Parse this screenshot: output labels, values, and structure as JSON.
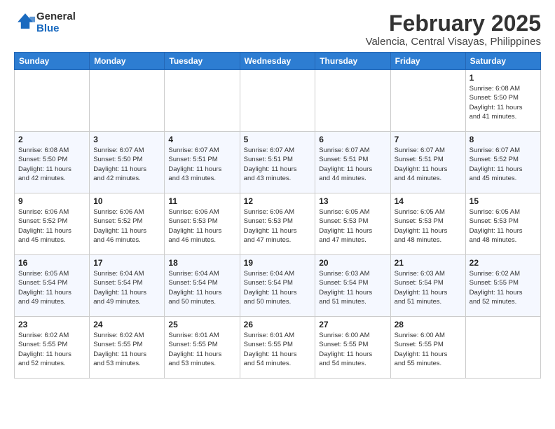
{
  "header": {
    "logo_general": "General",
    "logo_blue": "Blue",
    "month_year": "February 2025",
    "location": "Valencia, Central Visayas, Philippines"
  },
  "days_of_week": [
    "Sunday",
    "Monday",
    "Tuesday",
    "Wednesday",
    "Thursday",
    "Friday",
    "Saturday"
  ],
  "weeks": [
    [
      {
        "day": "",
        "info": ""
      },
      {
        "day": "",
        "info": ""
      },
      {
        "day": "",
        "info": ""
      },
      {
        "day": "",
        "info": ""
      },
      {
        "day": "",
        "info": ""
      },
      {
        "day": "",
        "info": ""
      },
      {
        "day": "1",
        "info": "Sunrise: 6:08 AM\nSunset: 5:50 PM\nDaylight: 11 hours\nand 41 minutes."
      }
    ],
    [
      {
        "day": "2",
        "info": "Sunrise: 6:08 AM\nSunset: 5:50 PM\nDaylight: 11 hours\nand 42 minutes."
      },
      {
        "day": "3",
        "info": "Sunrise: 6:07 AM\nSunset: 5:50 PM\nDaylight: 11 hours\nand 42 minutes."
      },
      {
        "day": "4",
        "info": "Sunrise: 6:07 AM\nSunset: 5:51 PM\nDaylight: 11 hours\nand 43 minutes."
      },
      {
        "day": "5",
        "info": "Sunrise: 6:07 AM\nSunset: 5:51 PM\nDaylight: 11 hours\nand 43 minutes."
      },
      {
        "day": "6",
        "info": "Sunrise: 6:07 AM\nSunset: 5:51 PM\nDaylight: 11 hours\nand 44 minutes."
      },
      {
        "day": "7",
        "info": "Sunrise: 6:07 AM\nSunset: 5:51 PM\nDaylight: 11 hours\nand 44 minutes."
      },
      {
        "day": "8",
        "info": "Sunrise: 6:07 AM\nSunset: 5:52 PM\nDaylight: 11 hours\nand 45 minutes."
      }
    ],
    [
      {
        "day": "9",
        "info": "Sunrise: 6:06 AM\nSunset: 5:52 PM\nDaylight: 11 hours\nand 45 minutes."
      },
      {
        "day": "10",
        "info": "Sunrise: 6:06 AM\nSunset: 5:52 PM\nDaylight: 11 hours\nand 46 minutes."
      },
      {
        "day": "11",
        "info": "Sunrise: 6:06 AM\nSunset: 5:53 PM\nDaylight: 11 hours\nand 46 minutes."
      },
      {
        "day": "12",
        "info": "Sunrise: 6:06 AM\nSunset: 5:53 PM\nDaylight: 11 hours\nand 47 minutes."
      },
      {
        "day": "13",
        "info": "Sunrise: 6:05 AM\nSunset: 5:53 PM\nDaylight: 11 hours\nand 47 minutes."
      },
      {
        "day": "14",
        "info": "Sunrise: 6:05 AM\nSunset: 5:53 PM\nDaylight: 11 hours\nand 48 minutes."
      },
      {
        "day": "15",
        "info": "Sunrise: 6:05 AM\nSunset: 5:53 PM\nDaylight: 11 hours\nand 48 minutes."
      }
    ],
    [
      {
        "day": "16",
        "info": "Sunrise: 6:05 AM\nSunset: 5:54 PM\nDaylight: 11 hours\nand 49 minutes."
      },
      {
        "day": "17",
        "info": "Sunrise: 6:04 AM\nSunset: 5:54 PM\nDaylight: 11 hours\nand 49 minutes."
      },
      {
        "day": "18",
        "info": "Sunrise: 6:04 AM\nSunset: 5:54 PM\nDaylight: 11 hours\nand 50 minutes."
      },
      {
        "day": "19",
        "info": "Sunrise: 6:04 AM\nSunset: 5:54 PM\nDaylight: 11 hours\nand 50 minutes."
      },
      {
        "day": "20",
        "info": "Sunrise: 6:03 AM\nSunset: 5:54 PM\nDaylight: 11 hours\nand 51 minutes."
      },
      {
        "day": "21",
        "info": "Sunrise: 6:03 AM\nSunset: 5:54 PM\nDaylight: 11 hours\nand 51 minutes."
      },
      {
        "day": "22",
        "info": "Sunrise: 6:02 AM\nSunset: 5:55 PM\nDaylight: 11 hours\nand 52 minutes."
      }
    ],
    [
      {
        "day": "23",
        "info": "Sunrise: 6:02 AM\nSunset: 5:55 PM\nDaylight: 11 hours\nand 52 minutes."
      },
      {
        "day": "24",
        "info": "Sunrise: 6:02 AM\nSunset: 5:55 PM\nDaylight: 11 hours\nand 53 minutes."
      },
      {
        "day": "25",
        "info": "Sunrise: 6:01 AM\nSunset: 5:55 PM\nDaylight: 11 hours\nand 53 minutes."
      },
      {
        "day": "26",
        "info": "Sunrise: 6:01 AM\nSunset: 5:55 PM\nDaylight: 11 hours\nand 54 minutes."
      },
      {
        "day": "27",
        "info": "Sunrise: 6:00 AM\nSunset: 5:55 PM\nDaylight: 11 hours\nand 54 minutes."
      },
      {
        "day": "28",
        "info": "Sunrise: 6:00 AM\nSunset: 5:55 PM\nDaylight: 11 hours\nand 55 minutes."
      },
      {
        "day": "",
        "info": ""
      }
    ]
  ]
}
